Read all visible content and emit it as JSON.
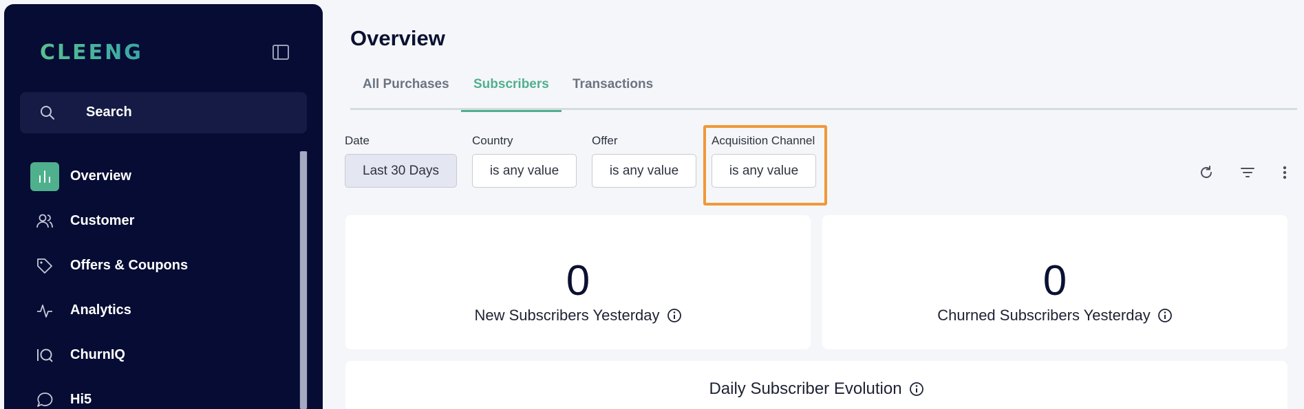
{
  "sidebar": {
    "logo_text": "CLEENG",
    "search_label": "Search",
    "items": [
      {
        "label": "Overview",
        "icon": "bar-chart-icon",
        "active": true
      },
      {
        "label": "Customer",
        "icon": "users-icon"
      },
      {
        "label": "Offers & Coupons",
        "icon": "tag-icon"
      },
      {
        "label": "Analytics",
        "icon": "activity-icon"
      },
      {
        "label": "ChurnIQ",
        "icon": "churn-iq-icon"
      },
      {
        "label": "Hi5",
        "icon": "chat-bubble-icon"
      }
    ]
  },
  "main": {
    "title": "Overview",
    "tabs": [
      {
        "label": "All Purchases"
      },
      {
        "label": "Subscribers",
        "active": true
      },
      {
        "label": "Transactions"
      }
    ],
    "filters": [
      {
        "label": "Date",
        "value": "Last 30 Days"
      },
      {
        "label": "Country",
        "value": "is any value"
      },
      {
        "label": "Offer",
        "value": "is any value"
      },
      {
        "label": "Acquisition Channel",
        "value": "is any value"
      }
    ],
    "cards": [
      {
        "value": "0",
        "caption": "New Subscribers Yesterday"
      },
      {
        "value": "0",
        "caption": "Churned Subscribers Yesterday"
      }
    ],
    "evolution_title": "Daily Subscriber Evolution"
  },
  "colors": {
    "sidebar_bg": "#060c33",
    "accent": "#4fb08d",
    "highlight": "#f0983a"
  }
}
